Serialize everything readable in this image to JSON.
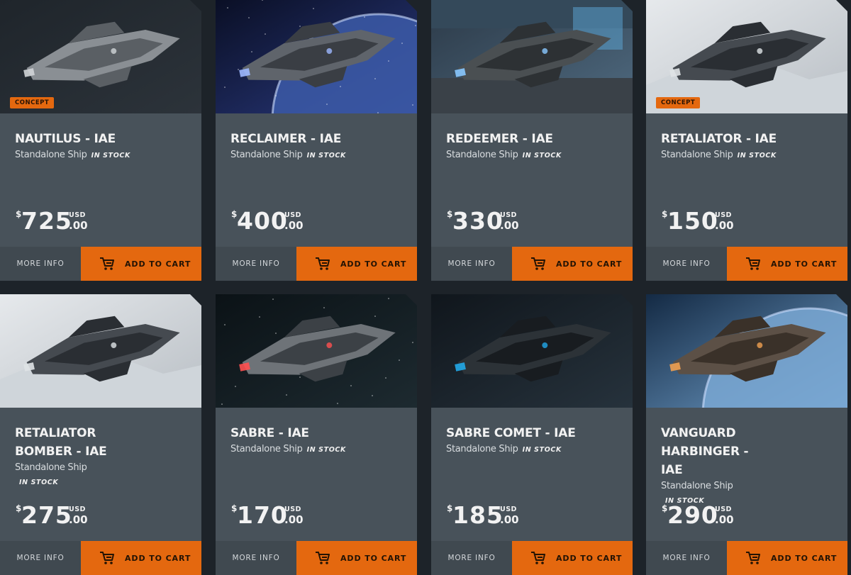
{
  "cards": [
    {
      "name": "NAUTILUS - IAE",
      "subtitle": "Standalone Ship",
      "stock": "IN STOCK",
      "currency": "$",
      "amount": "725",
      "cents": ".00",
      "usd": "USD",
      "badge": "CONCEPT",
      "more": "MORE INFO",
      "cart": "ADD TO CART",
      "scene": "grey-dark"
    },
    {
      "name": "RECLAIMER - IAE",
      "subtitle": "Standalone Ship",
      "stock": "IN STOCK",
      "currency": "$",
      "amount": "400",
      "cents": ".00",
      "usd": "USD",
      "badge": "",
      "more": "MORE INFO",
      "cart": "ADD TO CART",
      "scene": "space-planet"
    },
    {
      "name": "REDEEMER - IAE",
      "subtitle": "Standalone Ship",
      "stock": "IN STOCK",
      "currency": "$",
      "amount": "330",
      "cents": ".00",
      "usd": "USD",
      "badge": "",
      "more": "MORE INFO",
      "cart": "ADD TO CART",
      "scene": "hangar"
    },
    {
      "name": "RETALIATOR - IAE",
      "subtitle": "Standalone Ship",
      "stock": "IN STOCK",
      "currency": "$",
      "amount": "150",
      "cents": ".00",
      "usd": "USD",
      "badge": "CONCEPT",
      "more": "MORE INFO",
      "cart": "ADD TO CART",
      "scene": "snow"
    },
    {
      "name": "RETALIATOR BOMBER - IAE",
      "subtitle": "Standalone Ship",
      "stock": "IN STOCK",
      "currency": "$",
      "amount": "275",
      "cents": ".00",
      "usd": "USD",
      "badge": "",
      "more": "MORE INFO",
      "cart": "ADD TO CART",
      "scene": "snow"
    },
    {
      "name": "SABRE - IAE",
      "subtitle": "Standalone Ship",
      "stock": "IN STOCK",
      "currency": "$",
      "amount": "170",
      "cents": ".00",
      "usd": "USD",
      "badge": "",
      "more": "MORE INFO",
      "cart": "ADD TO CART",
      "scene": "space-dark"
    },
    {
      "name": "SABRE COMET - IAE",
      "subtitle": "Standalone Ship",
      "stock": "IN STOCK",
      "currency": "$",
      "amount": "185",
      "cents": ".00",
      "usd": "USD",
      "badge": "",
      "more": "MORE INFO",
      "cart": "ADD TO CART",
      "scene": "dark-blue"
    },
    {
      "name": "VANGUARD HARBINGER - IAE",
      "subtitle": "Standalone Ship",
      "stock": "IN STOCK",
      "currency": "$",
      "amount": "290",
      "cents": ".00",
      "usd": "USD",
      "badge": "",
      "more": "MORE INFO",
      "cart": "ADD TO CART",
      "scene": "ocean-planet"
    }
  ],
  "colors": {
    "accent": "#e4680f",
    "card": "#48525a",
    "page": "#1d2329"
  },
  "icons": {
    "cart": "shopping-cart-icon"
  }
}
